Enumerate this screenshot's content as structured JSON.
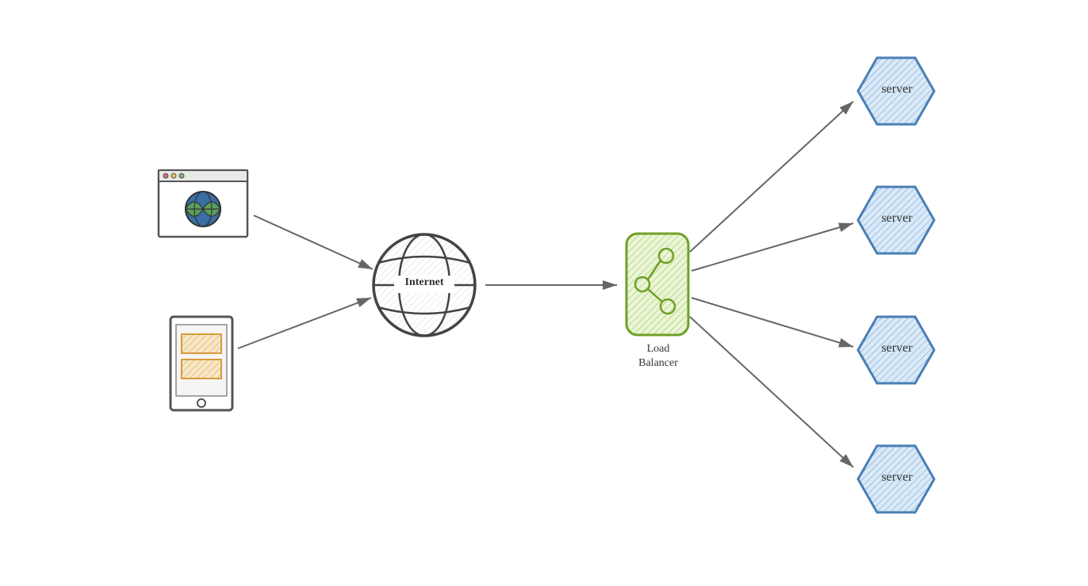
{
  "nodes": {
    "internet": {
      "label": "Internet"
    },
    "loadBalancer": {
      "label1": "Load",
      "label2": "Balancer"
    },
    "servers": [
      {
        "label": "server"
      },
      {
        "label": "server"
      },
      {
        "label": "server"
      },
      {
        "label": "server"
      }
    ]
  },
  "clients": {
    "browser": "web-browser",
    "mobile": "mobile-device"
  }
}
